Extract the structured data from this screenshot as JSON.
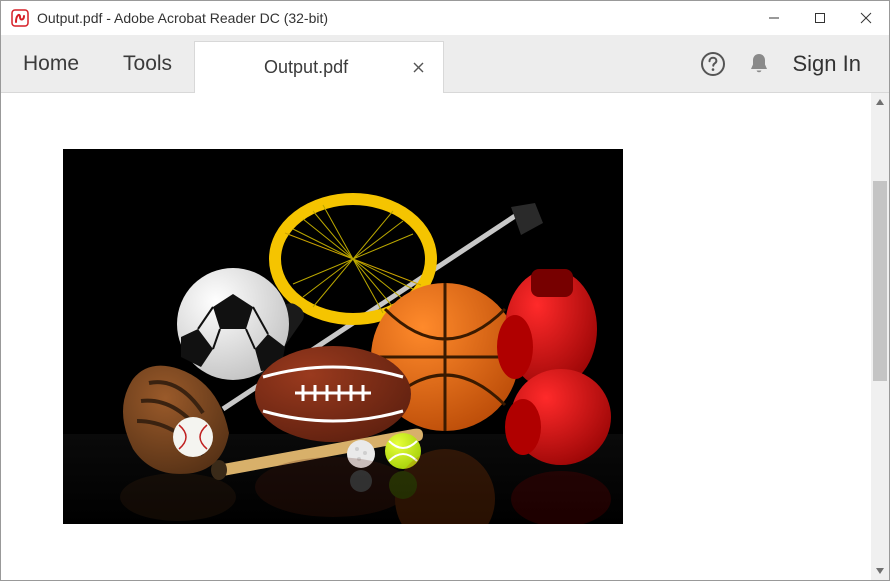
{
  "window": {
    "title": "Output.pdf - Adobe Acrobat Reader DC (32-bit)"
  },
  "toolbar": {
    "home_label": "Home",
    "tools_label": "Tools",
    "signin_label": "Sign In"
  },
  "tab": {
    "label": "Output.pdf"
  },
  "document": {
    "image_description": "Sports equipment on black background: soccer ball, basketball, American football, baseball with glove and bat, tennis ball and racket, golf ball and club, boxing gloves"
  }
}
